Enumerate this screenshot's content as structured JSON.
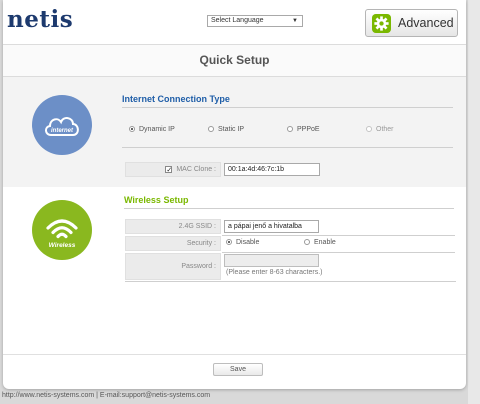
{
  "header": {
    "logo_text": "netis",
    "language_select": {
      "value": "Select Language"
    },
    "advanced_label": "Advanced"
  },
  "page": {
    "title": "Quick Setup"
  },
  "internet": {
    "icon_label": "internet",
    "title": "Internet Connection Type",
    "options": [
      {
        "label": "Dynamic IP",
        "selected": true,
        "enabled": true
      },
      {
        "label": "Static IP",
        "selected": false,
        "enabled": true
      },
      {
        "label": "PPPoE",
        "selected": false,
        "enabled": true
      },
      {
        "label": "Other",
        "selected": false,
        "enabled": false
      }
    ],
    "mac_clone": {
      "label": "MAC Clone :",
      "checked": true,
      "value": "00:1a:4d:46:7c:1b"
    }
  },
  "wireless": {
    "icon_label": "Wireless",
    "title": "Wireless Setup",
    "ssid": {
      "label": "2.4G SSID :",
      "value": "a pápai jenő a hivatalba"
    },
    "security": {
      "label": "Security :",
      "options": [
        {
          "label": "Disable",
          "selected": true
        },
        {
          "label": "Enable",
          "selected": false
        }
      ]
    },
    "password": {
      "label": "Password :",
      "value": "",
      "hint": "(Please enter 8-63 characters.)"
    }
  },
  "actions": {
    "save_label": "Save"
  },
  "footer": {
    "text": "http://www.netis-systems.com | E-mail:support@netis-systems.com"
  },
  "colors": {
    "brand": "#1d3a6e",
    "accent_green": "#7ab800",
    "internet_blue": "#6c8fc7",
    "wireless_green": "#8ab81f"
  }
}
